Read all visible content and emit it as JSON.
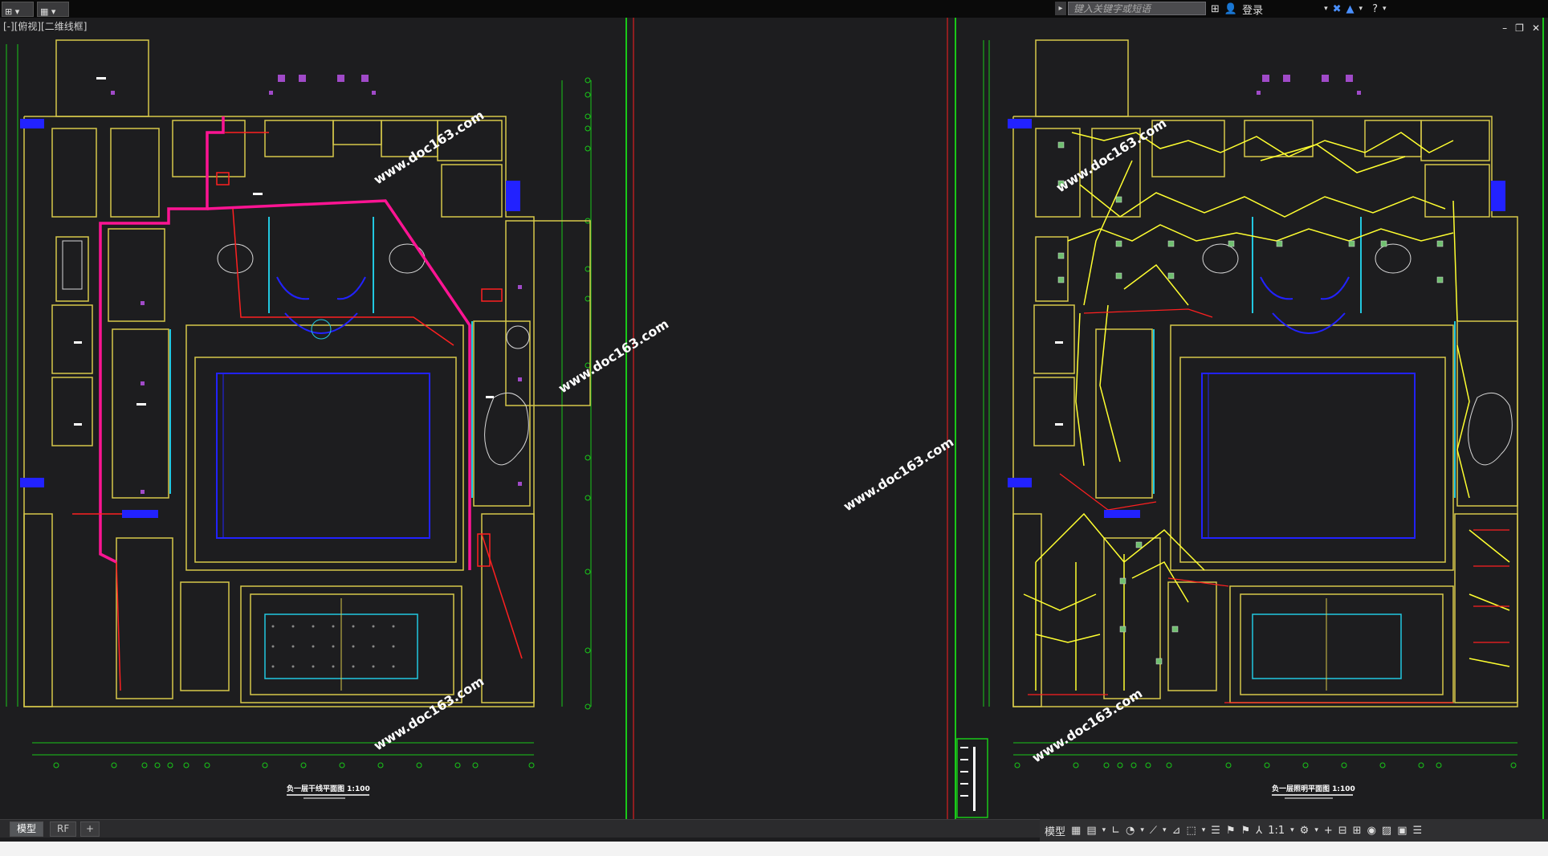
{
  "toolbar": {
    "search_placeholder": "键入关键字或短语",
    "login_label": "登录"
  },
  "view_label": "[-][俯视][二维线框]",
  "drawings": {
    "left_title": "负一层干线平面图   1:100",
    "right_title": "负一层照明平面图   1:100"
  },
  "watermark": "www.doc163.com",
  "tabs": [
    "模型",
    "RF",
    "+"
  ],
  "status": {
    "model_label": "模型",
    "scale": "1:1"
  },
  "colors": {
    "wall": "#d6c84a",
    "grid": "#19c819",
    "blue": "#2222ff",
    "cyan": "#22c8e0",
    "magenta": "#ff1493",
    "red": "#ff2020",
    "yellow": "#ffff30"
  }
}
